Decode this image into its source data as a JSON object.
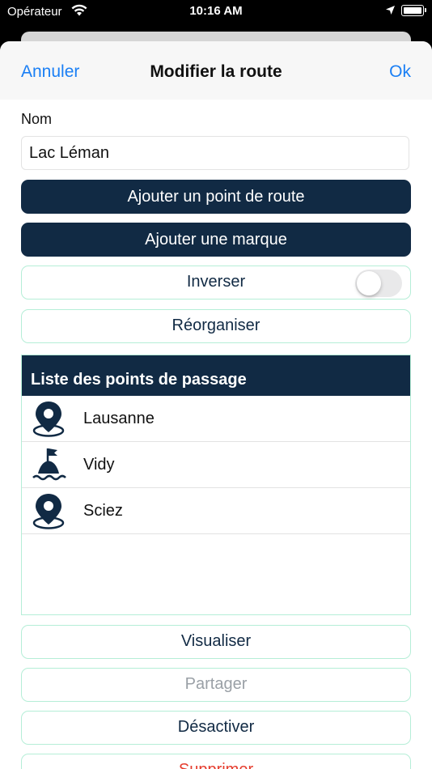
{
  "status_bar": {
    "carrier": "Opérateur",
    "time": "10:16 AM"
  },
  "nav": {
    "cancel_label": "Annuler",
    "title": "Modifier la route",
    "ok_label": "Ok"
  },
  "form": {
    "name_label": "Nom",
    "name_value": "Lac Léman"
  },
  "buttons": {
    "add_waypoint": "Ajouter un point de route",
    "add_mark": "Ajouter une marque",
    "reverse": "Inverser",
    "reorder": "Réorganiser",
    "visualize": "Visualiser",
    "share": "Partager",
    "deactivate": "Désactiver",
    "delete": "Supprimer"
  },
  "reverse_toggle_on": false,
  "waypoints": {
    "header": "Liste des points de passage",
    "items": [
      {
        "label": "Lausanne",
        "icon": "map-pin-icon"
      },
      {
        "label": "Vidy",
        "icon": "buoy-icon"
      },
      {
        "label": "Sciez",
        "icon": "map-pin-icon"
      }
    ]
  },
  "colors": {
    "primary_dark": "#112a44",
    "link_blue": "#1a7ff5",
    "outline": "#b5eed7",
    "danger": "#e53b2c"
  }
}
